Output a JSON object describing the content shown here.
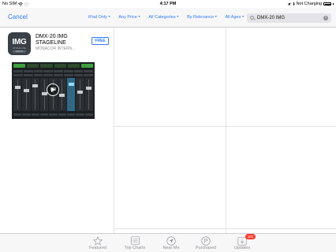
{
  "status_bar": {
    "carrier": "No SIM",
    "time": "4:17 PM",
    "charging": "Not Charging"
  },
  "nav": {
    "cancel_label": "Cancel",
    "filters": [
      {
        "label": "iPad Only"
      },
      {
        "label": "Any Price"
      },
      {
        "label": "All Categories"
      },
      {
        "label": "By Relevance"
      },
      {
        "label": "All Ages"
      }
    ],
    "search_value": "DMX-20 IMG"
  },
  "result": {
    "app_name": "DMX-20 IMG STAGELINE",
    "developer": "MONACOR INTERN...",
    "price_button": "FREE",
    "icon_text": "IMG",
    "icon_subtext": "STAGELINE",
    "icon_badge": "DMX-20"
  },
  "tab_bar": {
    "items": [
      {
        "label": "Featured",
        "icon": "star-icon"
      },
      {
        "label": "Top Charts",
        "icon": "list-icon"
      },
      {
        "label": "Near Me",
        "icon": "location-icon"
      },
      {
        "label": "Purchased",
        "icon": "purchased-icon"
      },
      {
        "label": "Updates",
        "icon": "updates-icon"
      }
    ],
    "updates_badge": "102"
  },
  "colors": {
    "accent": "#2f7bf5",
    "badge": "#ff3b30"
  }
}
